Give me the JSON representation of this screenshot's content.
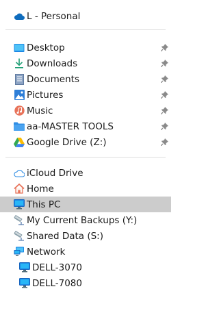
{
  "account": {
    "label": "L - Personal"
  },
  "quick_access": [
    {
      "label": "Desktop",
      "icon": "desktop-folder-icon",
      "pinned": true
    },
    {
      "label": "Downloads",
      "icon": "download-arrow-icon",
      "pinned": true
    },
    {
      "label": "Documents",
      "icon": "documents-icon",
      "pinned": true
    },
    {
      "label": "Pictures",
      "icon": "pictures-icon",
      "pinned": true
    },
    {
      "label": "Music",
      "icon": "music-icon",
      "pinned": true
    },
    {
      "label": "aa-MASTER TOOLS",
      "icon": "folder-icon",
      "pinned": true
    },
    {
      "label": "Google Drive (Z:)",
      "icon": "google-drive-icon",
      "pinned": true
    }
  ],
  "locations": [
    {
      "label": "iCloud Drive",
      "icon": "cloud-icon"
    },
    {
      "label": "Home",
      "icon": "home-icon"
    },
    {
      "label": "This PC",
      "icon": "monitor-icon",
      "selected": true
    },
    {
      "label": "My Current Backups (Y:)",
      "icon": "network-drive-icon"
    },
    {
      "label": "Shared Data (S:)",
      "icon": "network-drive-icon"
    },
    {
      "label": "Network",
      "icon": "network-icon"
    }
  ],
  "network_devices": [
    {
      "label": "DELL-3070",
      "icon": "monitor-icon"
    },
    {
      "label": "DELL-7080",
      "icon": "monitor-icon"
    }
  ],
  "colors": {
    "selection": "#cccccc",
    "divider": "#dddddd",
    "onedrive_blue": "#0f6cbd",
    "folder_blue": "#2f8de4",
    "pin_gray": "#8a8a8a"
  }
}
